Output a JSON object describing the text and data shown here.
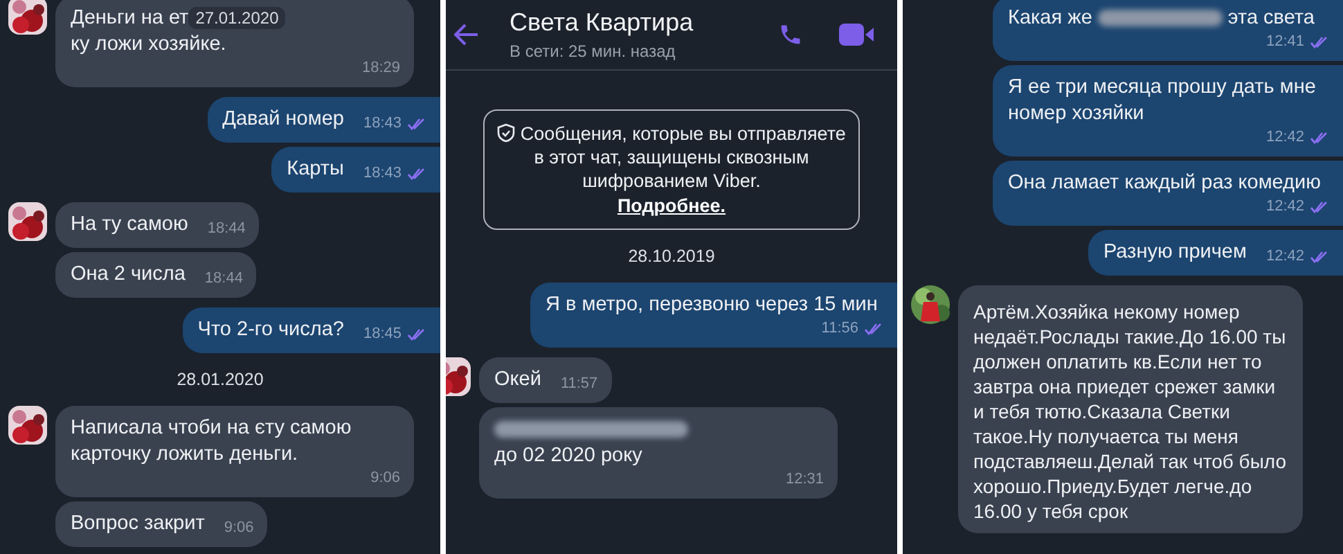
{
  "panels": [
    {
      "items": [
        {
          "kind": "message",
          "outgoing": false,
          "avatar": true,
          "segments": [
            {
              "kind": "text",
              "text": "Деньги на ет"
            },
            {
              "kind": "date",
              "text": "27.01.2020"
            },
            {
              "kind": "text",
              "text": "ку ложи"
            },
            {
              "kind": "text",
              "text": "хозяйке."
            }
          ],
          "time": "18:29"
        },
        {
          "kind": "message",
          "outgoing": true,
          "read": true,
          "segments": [
            {
              "kind": "text",
              "text": "Давай номер"
            }
          ],
          "time": "18:43"
        },
        {
          "kind": "message",
          "outgoing": true,
          "read": true,
          "segments": [
            {
              "kind": "text",
              "text": "Карты"
            }
          ],
          "time": "18:43"
        },
        {
          "kind": "message",
          "outgoing": false,
          "avatar": true,
          "segments": [
            {
              "kind": "text",
              "text": "На ту самою"
            }
          ],
          "time": "18:44"
        },
        {
          "kind": "message",
          "outgoing": false,
          "avatar": false,
          "segments": [
            {
              "kind": "text",
              "text": "Она 2 числа"
            }
          ],
          "time": "18:44"
        },
        {
          "kind": "message",
          "outgoing": true,
          "read": true,
          "segments": [
            {
              "kind": "text",
              "text": "Что 2-го числа?"
            }
          ],
          "time": "18:45"
        },
        {
          "kind": "date",
          "text": "28.01.2020"
        },
        {
          "kind": "message",
          "outgoing": false,
          "avatar": true,
          "segments": [
            {
              "kind": "text",
              "text": "Написала чтоби на єту самою карточку ложить деньги."
            }
          ],
          "time": "9:06"
        },
        {
          "kind": "message",
          "outgoing": false,
          "avatar": false,
          "segments": [
            {
              "kind": "text",
              "text": "Вопрос закрит"
            }
          ],
          "time": "9:06"
        }
      ]
    },
    {
      "header": {
        "title": "Света Квартира",
        "status": "В сети: 25 мин. назад"
      },
      "notice": {
        "text": "Сообщения, которые вы отправляете в этот чат, защищены сквозным шифрованием Viber.",
        "link": "Подробнее."
      },
      "items": [
        {
          "kind": "date",
          "text": "28.10.2019"
        },
        {
          "kind": "message",
          "outgoing": true,
          "read": true,
          "segments": [
            {
              "kind": "text",
              "text": "Я в метро, перезвоню через 15 мин"
            }
          ],
          "time": "11:56"
        },
        {
          "kind": "message",
          "outgoing": false,
          "avatar": true,
          "segments": [
            {
              "kind": "text",
              "text": "Окей"
            }
          ],
          "time": "11:57"
        },
        {
          "kind": "message",
          "outgoing": false,
          "avatar": false,
          "segments": [
            {
              "kind": "redacted"
            },
            {
              "kind": "text",
              "text": "до 02 2020"
            },
            {
              "kind": "text",
              "text": "року"
            }
          ],
          "time": "12:31"
        }
      ]
    },
    {
      "items": [
        {
          "kind": "message",
          "outgoing": true,
          "read": true,
          "segments": [
            {
              "kind": "text",
              "text": "Какая же"
            },
            {
              "kind": "redacted"
            },
            {
              "kind": "text",
              "text": "эта света"
            }
          ],
          "time": "12:41"
        },
        {
          "kind": "message",
          "outgoing": true,
          "read": true,
          "segments": [
            {
              "kind": "text",
              "text": "Я ее три месяца прошу дать мне номер хозяйки"
            }
          ],
          "time": "12:42"
        },
        {
          "kind": "message",
          "outgoing": true,
          "read": true,
          "segments": [
            {
              "kind": "text",
              "text": "Она ламает каждый раз комедию"
            }
          ],
          "time": "12:42"
        },
        {
          "kind": "message",
          "outgoing": true,
          "read": true,
          "segments": [
            {
              "kind": "text",
              "text": "Разную причем"
            }
          ],
          "time": "12:42"
        },
        {
          "kind": "message",
          "outgoing": false,
          "avatar": true,
          "segments": [
            {
              "kind": "text",
              "text": "Артём.Хозяйка некому номер недаёт.Рослады такие.До 16.00 ты должен оплатить кв.Если нет то завтра она приедет срежет замки и тебя тютю.Сказала Светки такое.Ну получаетса ты меня подставляеш.Делай так чтоб было хорошо.Приеду.Будет легче.до 16.00 у тебя срок"
            }
          ]
        }
      ]
    }
  ]
}
